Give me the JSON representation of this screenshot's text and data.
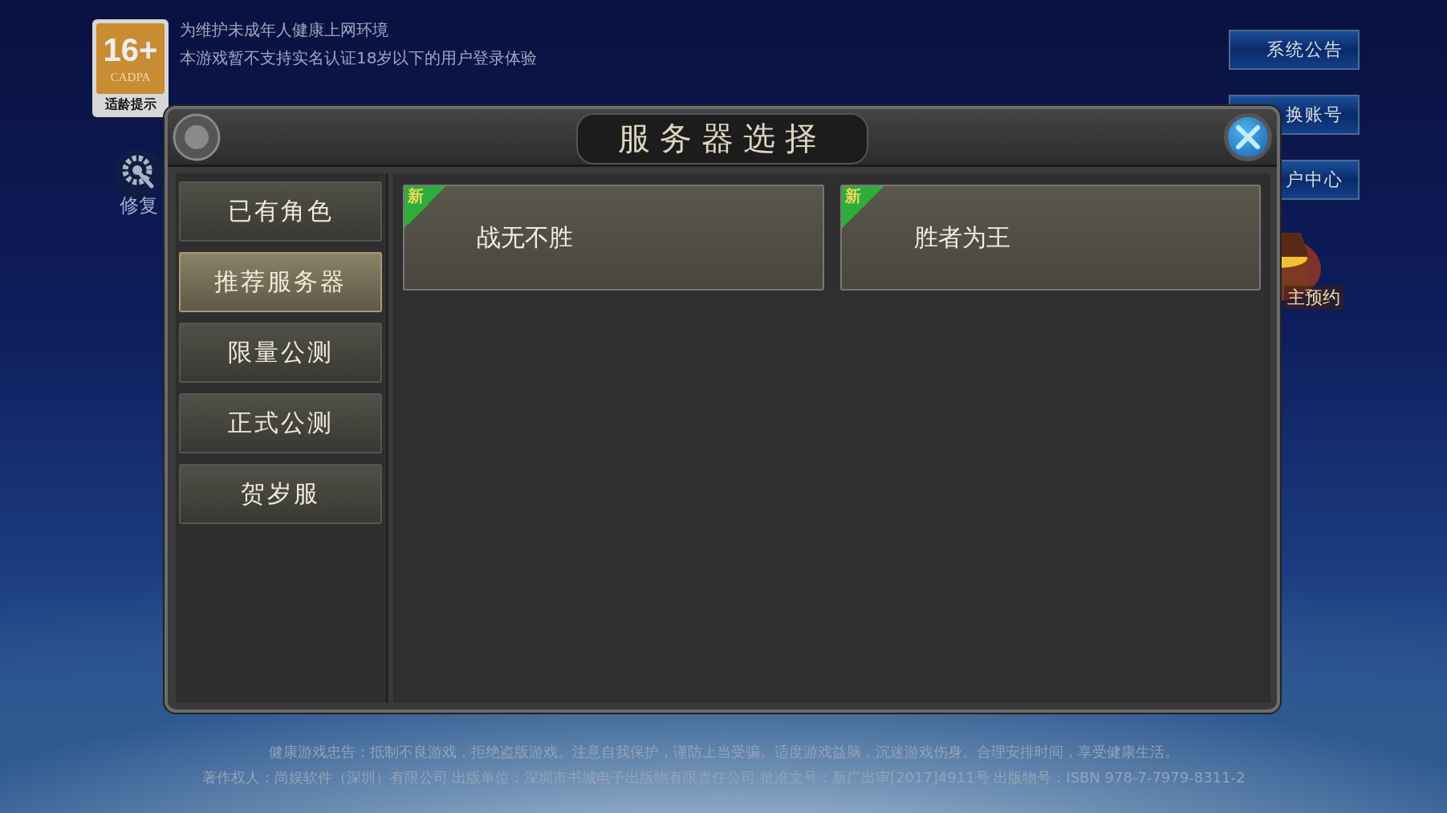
{
  "age_badge": {
    "rating": "16+",
    "org": "CADPA",
    "caption": "适龄提示"
  },
  "notice": [
    "为维护未成年人健康上网环境",
    "本游戏暂不支持实名认证18岁以下的用户登录体验"
  ],
  "repair": {
    "label": "修复"
  },
  "side_buttons": [
    {
      "kind": "button",
      "label": "系统公告"
    },
    {
      "kind": "button",
      "label": "换账号"
    },
    {
      "kind": "button",
      "label": "户中心"
    },
    {
      "kind": "chest",
      "label": "主预约"
    }
  ],
  "dialog": {
    "title": "服务器选择",
    "categories": [
      {
        "label": "已有角色",
        "selected": false
      },
      {
        "label": "推荐服务器",
        "selected": true
      },
      {
        "label": "限量公测",
        "selected": false
      },
      {
        "label": "正式公测",
        "selected": false
      },
      {
        "label": "贺岁服",
        "selected": false
      }
    ],
    "servers": [
      {
        "name": "战无不胜",
        "badge": "新"
      },
      {
        "name": "胜者为王",
        "badge": "新"
      }
    ]
  },
  "footer": [
    "健康游戏忠告：抵制不良游戏，拒绝盗版游戏。注意自我保护，谨防上当受骗。适度游戏益脑，沉迷游戏伤身。合理安排时间，享受健康生活。",
    "著作权人：尚娱软件（深圳）有限公司 出版单位：深圳市书城电子出版物有限责任公司 批准文号：新广出审[2017]4911号 出版物号：ISBN 978-7-7979-8311-2"
  ]
}
